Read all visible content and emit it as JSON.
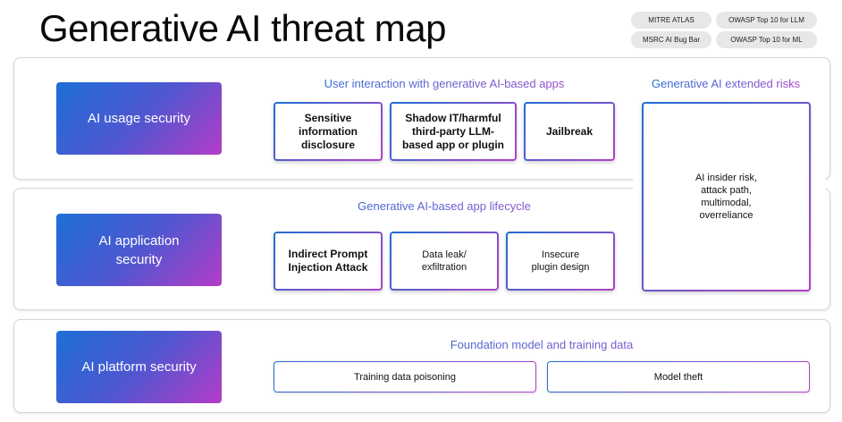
{
  "title": "Generative AI threat map",
  "tags": [
    "MITRE ATLAS",
    "OWASP Top 10 for LLM",
    "MSRC AI Bug Bar",
    "OWASP Top 10 for ML"
  ],
  "rows": [
    {
      "label": "AI usage security",
      "heading": "User interaction with generative AI-based apps",
      "cards": [
        "Sensitive information disclosure",
        "Shadow IT/harmful third-party LLM-based app or plugin",
        "Jailbreak"
      ]
    },
    {
      "label": "AI application security",
      "heading": "Generative AI-based app lifecycle",
      "cards": [
        "Indirect Prompt Injection Attack",
        "Data leak/ exfiltration",
        "Insecure plugin design"
      ]
    },
    {
      "label": "AI platform security",
      "heading": "Foundation model and training data",
      "cards": [
        "Training data poisoning",
        "Model theft"
      ]
    }
  ],
  "extended": {
    "heading": "Generative AI extended risks",
    "text": "AI insider risk, attack path, multimodal, overreliance"
  }
}
